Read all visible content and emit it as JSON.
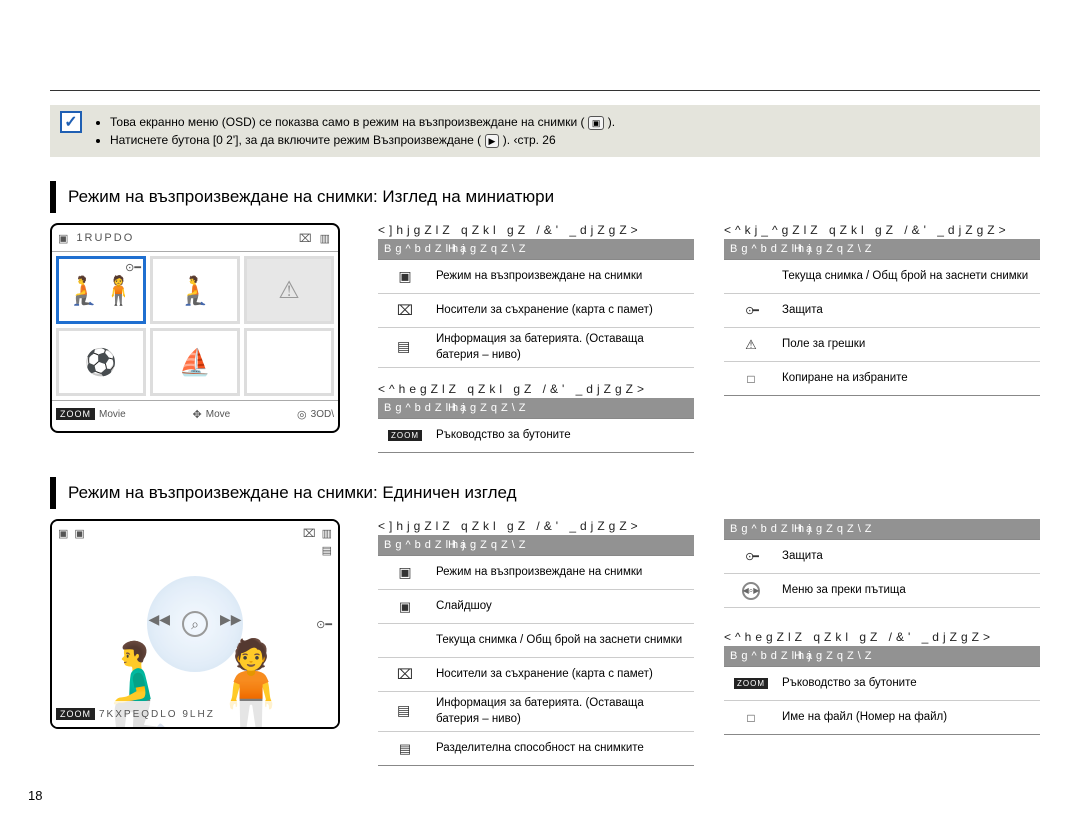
{
  "note": {
    "line1_a": "Това екранно меню (OSD) се показва само в режим на възпроизвеждане на снимки (",
    "line1_b": ").",
    "line2_a": "Натиснете бутона [0 2'], за да включите режим Възпроизвеждане (",
    "line2_b": ").  ‹стр. 26"
  },
  "section1": {
    "heading": "Режим на възпроизвеждане на снимки: Изглед на миниатюри",
    "osd": {
      "title": "1RUPDO",
      "bottom_movie": "Movie",
      "bottom_move": "Move",
      "bottom_play": "3OD\\",
      "zoom": "ZOOM"
    },
    "topA": {
      "title": "<]hjgZlZ qZkl gZ /&' _djZgZ>",
      "hdr_icon": "Bg^bdZlhj",
      "hdr_meaning": "HagZqZ\\Z",
      "rows": [
        {
          "icon": "photo",
          "text": "Режим на възпроизвеждане на снимки"
        },
        {
          "icon": "card",
          "text": "Носители за съхранение (карта с памет)"
        },
        {
          "icon": "batt",
          "text": "Информация за батерията. (Оставаща батерия – ниво)"
        }
      ]
    },
    "topB": {
      "title": "<^kj_^gZlZ qZkl gZ /&' _djZgZ>",
      "hdr_icon": "Bg^bdZlhj",
      "hdr_meaning": "HagZqZ\\Z",
      "rows": [
        {
          "icon": "",
          "text": "Текуща снимка / Общ брой на заснети снимки"
        },
        {
          "icon": "lock",
          "text": "Защита"
        },
        {
          "icon": "warn",
          "text": "Поле за грешки"
        },
        {
          "icon": "copy",
          "text": "Копиране на избраните"
        }
      ]
    },
    "bottomA": {
      "title": "<^hegZlZ qZkl gZ /&' _djZgZ>",
      "hdr_icon": "Bg^bdZlhj",
      "hdr_meaning": "HagZqZ\\Z",
      "rows": [
        {
          "icon": "zoom",
          "text": "Ръководство за бутоните"
        }
      ]
    }
  },
  "section2": {
    "heading": "Режим на възпроизвеждане на снимки: Единичен изглед",
    "osd": {
      "bottom_text": "7KXPEQDLO 9LHZ",
      "zoom": "ZOOM"
    },
    "topA": {
      "title": "<]hjgZlZ qZkl gZ /&' _djZgZ>",
      "hdr_icon": "Bg^bdZlhj",
      "hdr_meaning": "HagZqZ\\Z",
      "rows": [
        {
          "icon": "photo",
          "text": "Режим на възпроизвеждане на снимки"
        },
        {
          "icon": "slide",
          "text": "Слайдшоу"
        },
        {
          "icon": "",
          "text": "Текуща снимка / Общ брой на заснети снимки"
        },
        {
          "icon": "card",
          "text": "Носители за съхранение (карта с памет)"
        },
        {
          "icon": "batt",
          "text": "Информация за батерията. (Оставаща батерия – ниво)"
        },
        {
          "icon": "res",
          "text": "Разделителна способност на снимките"
        }
      ]
    },
    "topB": {
      "hdr_icon": "Bg^bdZlhj",
      "hdr_meaning": "HagZqZ\\Z",
      "rows": [
        {
          "icon": "lock",
          "text": "Защита"
        },
        {
          "icon": "disc",
          "text": "Меню за преки пътища"
        }
      ]
    },
    "bottomB": {
      "title": "<^hegZlZ qZkl gZ /&' _djZgZ>",
      "hdr_icon": "Bg^bdZlhj",
      "hdr_meaning": "HagZqZ\\Z",
      "rows": [
        {
          "icon": "zoom",
          "text": "Ръководство за бутоните"
        },
        {
          "icon": "file",
          "text": "Име на файл (Номер на файл)"
        }
      ]
    }
  },
  "page_number": "18"
}
